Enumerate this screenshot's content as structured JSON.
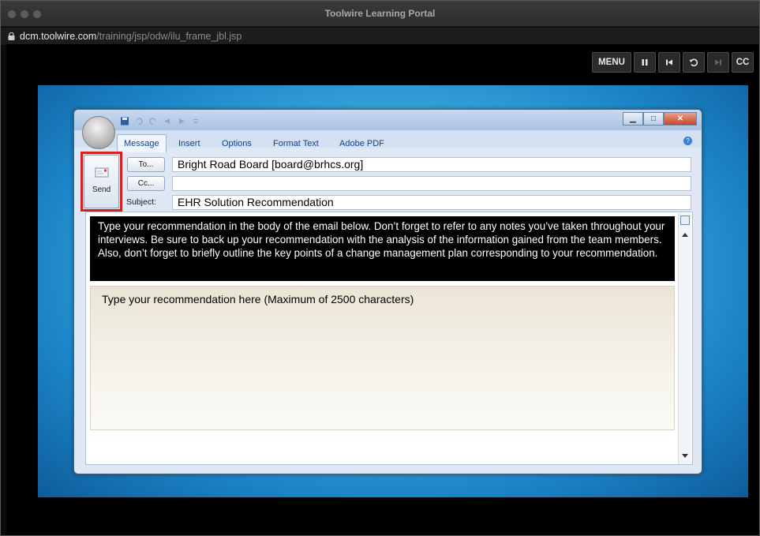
{
  "browser": {
    "window_title": "Toolwire Learning Portal",
    "url_domain": "dcm.toolwire.com",
    "url_path": "/training/jsp/odw/ilu_frame_jbl.jsp"
  },
  "player_controls": {
    "menu_label": "MENU",
    "pause_icon": "pause-icon",
    "restart_icon": "skip-back-icon",
    "replay_icon": "replay-icon",
    "next_icon": "skip-forward-icon",
    "cc_label": "CC"
  },
  "email": {
    "ribbon_tabs": [
      "Message",
      "Insert",
      "Options",
      "Format Text",
      "Adobe PDF"
    ],
    "send_label": "Send",
    "to_button": "To...",
    "cc_button": "Cc...",
    "subject_label": "Subject:",
    "to_value": "Bright Road Board [board@brhcs.org]",
    "cc_value": "",
    "subject_value": "EHR Solution Recommendation",
    "instructions": "Type your recommendation in the body of the email below. Don’t forget to refer to any notes you’ve taken throughout your interviews. Be sure to back up your recommendation with the analysis of the information gained from the team members. Also, don’t forget to briefly outline the key points of a change management plan corresponding to your recommendation.",
    "body_placeholder": "Type your recommendation here (Maximum of 2500 characters)"
  },
  "colors": {
    "highlight": "#d9201c",
    "link_blue": "#15428b"
  }
}
